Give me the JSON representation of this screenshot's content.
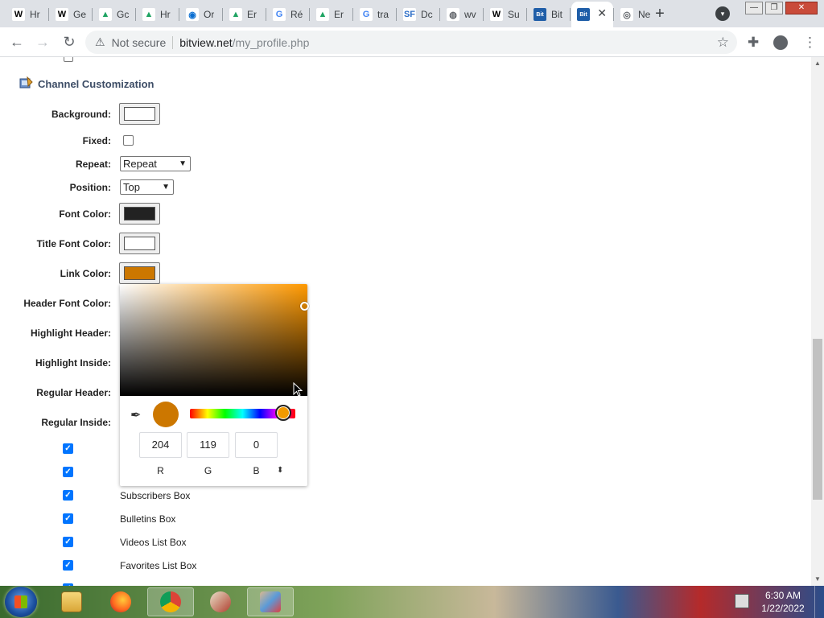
{
  "browser": {
    "tabs": [
      {
        "icon": "wikipedia-icon",
        "glyph": "W",
        "title": "Hr",
        "fav_bg": "#ffffff",
        "fav_fg": "#000000"
      },
      {
        "icon": "wikipedia-icon",
        "glyph": "W",
        "title": "Ge",
        "fav_bg": "#ffffff",
        "fav_fg": "#000000"
      },
      {
        "icon": "google-drive-icon",
        "glyph": "▲",
        "title": "Gc",
        "fav_bg": "#ffffff",
        "fav_fg": "#1fa463"
      },
      {
        "icon": "google-drive-icon",
        "glyph": "▲",
        "title": "Hr",
        "fav_bg": "#ffffff",
        "fav_fg": "#1fa463"
      },
      {
        "icon": "onedrive-icon",
        "glyph": "◉",
        "title": "Or",
        "fav_bg": "#ffffff",
        "fav_fg": "#0a6ed1"
      },
      {
        "icon": "google-drive-icon",
        "glyph": "▲",
        "title": "Er",
        "fav_bg": "#ffffff",
        "fav_fg": "#1fa463"
      },
      {
        "icon": "google-icon",
        "glyph": "G",
        "title": "Ré",
        "fav_bg": "#ffffff",
        "fav_fg": "#4285f4"
      },
      {
        "icon": "google-drive-icon",
        "glyph": "▲",
        "title": "Er",
        "fav_bg": "#ffffff",
        "fav_fg": "#1fa463"
      },
      {
        "icon": "google-icon",
        "glyph": "G",
        "title": "tra",
        "fav_bg": "#ffffff",
        "fav_fg": "#4285f4"
      },
      {
        "icon": "sf-icon",
        "glyph": "SF",
        "title": "Dc",
        "fav_bg": "#ffffff",
        "fav_fg": "#2d6ec7"
      },
      {
        "icon": "globe-icon",
        "glyph": "◍",
        "title": "wv",
        "fav_bg": "#ffffff",
        "fav_fg": "#5f6368"
      },
      {
        "icon": "wikipedia-icon",
        "glyph": "W",
        "title": "Su",
        "fav_bg": "#ffffff",
        "fav_fg": "#000000"
      },
      {
        "icon": "bitview-icon",
        "glyph": "Bit",
        "title": "Bit",
        "fav_bg": "#1f5ea8",
        "fav_fg": "#ffffff"
      },
      {
        "icon": "bitview-icon",
        "glyph": "Bit",
        "title": "",
        "fav_bg": "#1f5ea8",
        "fav_fg": "#ffffff",
        "active": true
      },
      {
        "icon": "chrome-icon",
        "glyph": "◎",
        "title": "Ne",
        "fav_bg": "#ffffff",
        "fav_fg": "#5f6368"
      }
    ],
    "window": {
      "minimize": "—",
      "maximize": "❐",
      "close": "✕"
    },
    "nav": {
      "back": "←",
      "forward": "→",
      "reload": "↻"
    },
    "address": {
      "security_label": "Not secure",
      "host": "bitview.net",
      "path": "/my_profile.php"
    }
  },
  "page": {
    "section_title": "Channel Customization",
    "fields": {
      "background": {
        "label": "Background:",
        "color": "#ffffff"
      },
      "fixed": {
        "label": "Fixed:",
        "checked": false
      },
      "repeat": {
        "label": "Repeat:",
        "value": "Repeat"
      },
      "position": {
        "label": "Position:",
        "value": "Top"
      },
      "font_color": {
        "label": "Font Color:",
        "color": "#222222"
      },
      "title_font_color": {
        "label": "Title Font Color:",
        "color": "#ffffff"
      },
      "link_color": {
        "label": "Link Color:",
        "color": "#cc7700"
      },
      "header_font_color": {
        "label": "Header Font Color:"
      },
      "highlight_header": {
        "label": "Highlight Header:"
      },
      "highlight_inside": {
        "label": "Highlight Inside:"
      },
      "regular_header": {
        "label": "Regular Header:"
      },
      "regular_inside": {
        "label": "Regular Inside:"
      }
    },
    "boxes": [
      {
        "label": "",
        "checked": true
      },
      {
        "label": "",
        "checked": true
      },
      {
        "label": "Subscribers Box",
        "checked": true
      },
      {
        "label": "Bulletins Box",
        "checked": true
      },
      {
        "label": "Videos List Box",
        "checked": true
      },
      {
        "label": "Favorites List Box",
        "checked": true
      }
    ]
  },
  "color_picker": {
    "r": "204",
    "g": "119",
    "b": "0",
    "r_label": "R",
    "g_label": "G",
    "b_label": "B",
    "current_color": "#cc7700",
    "hue_color": "#ff9900"
  },
  "taskbar": {
    "apps": [
      "file-explorer",
      "firefox",
      "chrome",
      "paint-brush",
      "paint"
    ],
    "active_app": "chrome",
    "time": "6:30 AM",
    "date": "1/22/2022"
  }
}
